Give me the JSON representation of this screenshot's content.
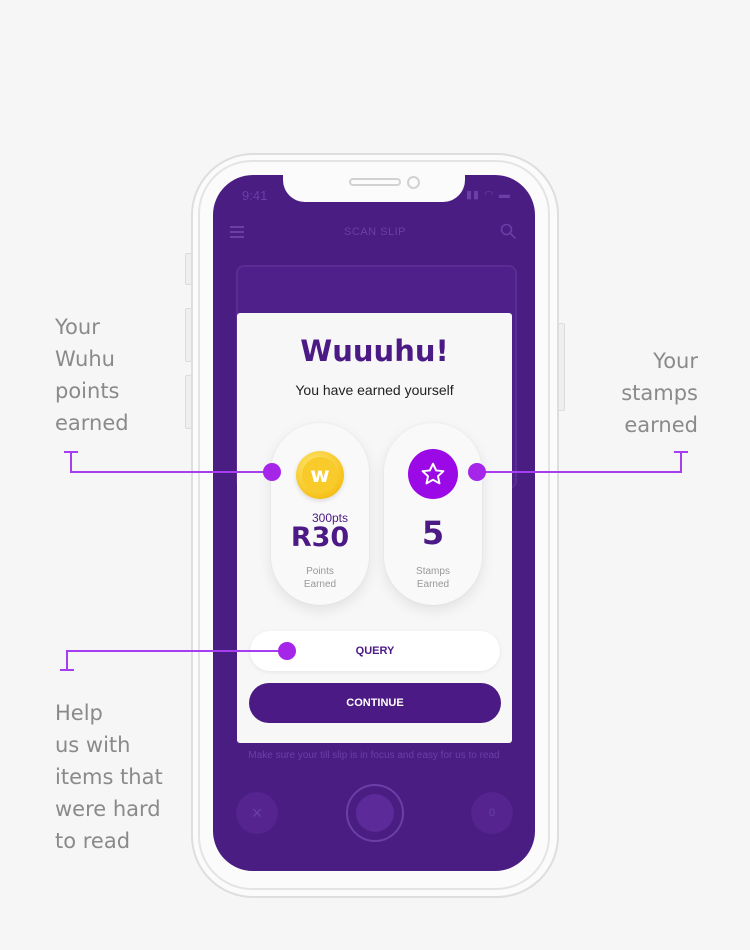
{
  "annotations": {
    "left_top": "Your\nWuhu\npoints\nearned",
    "right_top": "Your\nstamps\nearned",
    "left_bottom": "Help\nus with\nitems that\nwere hard\nto read"
  },
  "status_bar": {
    "time": "9:41",
    "icons": "▮▮ ◠ ▬"
  },
  "app_header": {
    "title": "SCAN SLIP",
    "menu_icon": "hamburger-menu-icon",
    "search_icon": "search-icon"
  },
  "scan_hint": "Make sure your till slip is in focus and easy for us to read",
  "camera_controls": {
    "close_symbol": "×",
    "count": "0"
  },
  "modal": {
    "title": "Wuuuhu!",
    "subtitle": "You have earned yourself",
    "points": {
      "icon_letter": "w",
      "pts": "300pts",
      "value": "R30",
      "label": "Points\nEarned"
    },
    "stamps": {
      "icon": "star-icon",
      "value": "5",
      "label": "Stamps\nEarned"
    },
    "query_button": "QUERY",
    "continue_button": "CONTINUE"
  },
  "colors": {
    "brand_purple": "#4b1a85",
    "accent_purple": "#9b0ae6",
    "annotation_line": "#a63df0",
    "coin_gold": "#f6c21b"
  }
}
